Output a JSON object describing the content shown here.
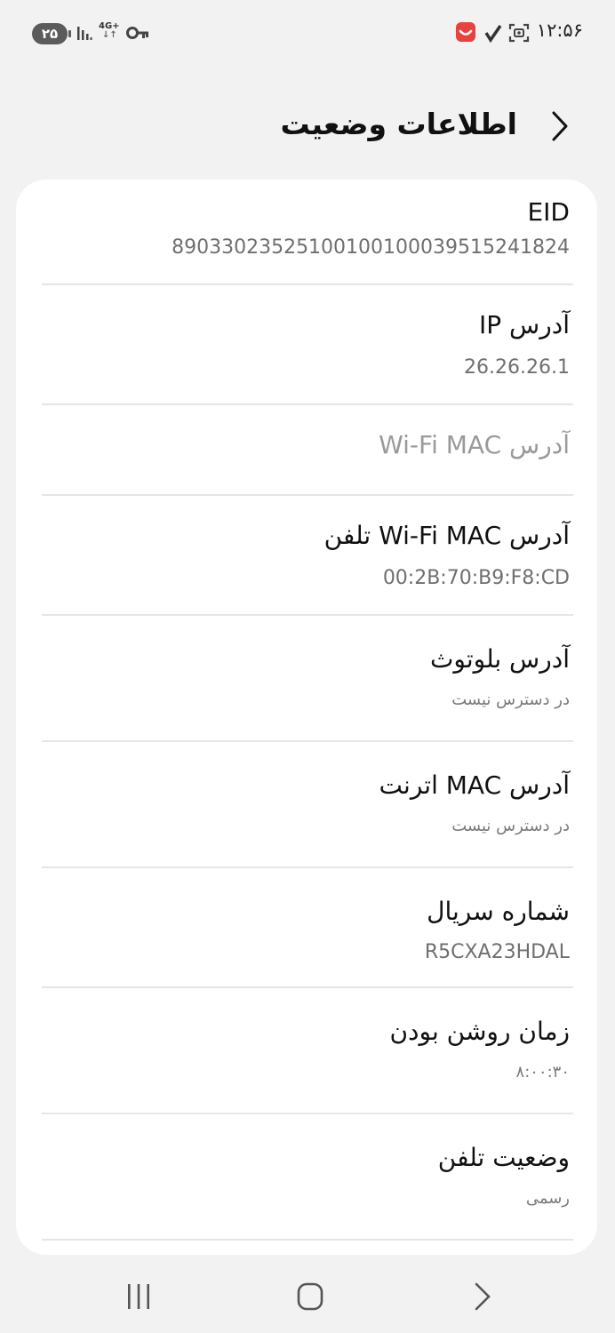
{
  "status_bar": {
    "clock": "۱۲:۵۶",
    "battery": "۲۵",
    "network": "4G+",
    "icons": [
      "recorder-icon",
      "check-icon",
      "screenshot-icon",
      "signal-icon",
      "key-icon"
    ],
    "accent_color": "#e8413e"
  },
  "header": {
    "title": "اطلاعات وضعیت"
  },
  "rows": [
    {
      "label": "EID",
      "value": "89033023525100100100039515241824"
    },
    {
      "label": "آدرس IP",
      "value": "26.26.26.1"
    },
    {
      "label": "آدرس Wi-Fi MAC",
      "value": ""
    },
    {
      "label": "آدرس Wi-Fi MAC تلفن",
      "value": "00:2B:70:B9:F8:CD"
    },
    {
      "label": "آدرس بلوتوث",
      "value": "در دسترس نیست"
    },
    {
      "label": "آدرس MAC اترنت",
      "value": "در دسترس نیست"
    },
    {
      "label": "شماره سریال",
      "value": "R5CXA23HDAL"
    },
    {
      "label": "زمان روشن بودن",
      "value": "۸:۰۰:۳۰"
    },
    {
      "label": "وضعیت تلفن",
      "value": "رسمی"
    }
  ],
  "nav_bar": {
    "icons": [
      "recents-icon",
      "home-icon",
      "back-icon"
    ]
  }
}
